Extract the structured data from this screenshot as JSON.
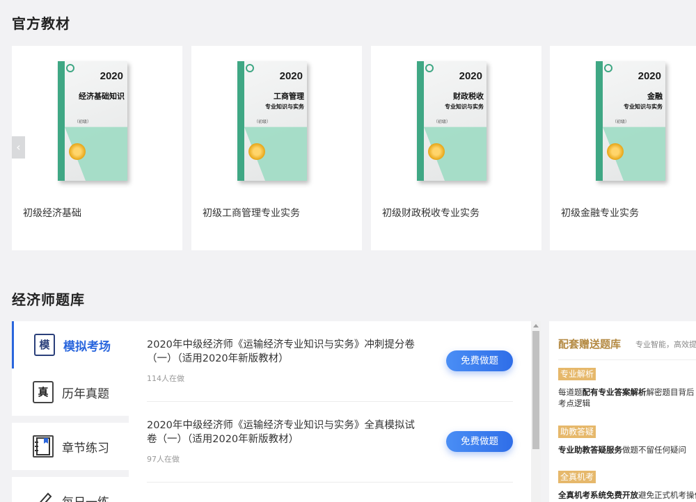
{
  "sections": {
    "textbooks_title": "官方教材",
    "bank_title": "经济师题库"
  },
  "textbooks": [
    {
      "title": "初级经济基础",
      "cover_year": "2020",
      "cover_name": "经济基础知识",
      "cover_sub": "",
      "cover_level": "（初级）"
    },
    {
      "title": "初级工商管理专业实务",
      "cover_year": "2020",
      "cover_name": "工商管理",
      "cover_sub": "专业知识与实务",
      "cover_level": "（初级）"
    },
    {
      "title": "初级财政税收专业实务",
      "cover_year": "2020",
      "cover_name": "财政税收",
      "cover_sub": "专业知识与实务",
      "cover_level": "（初级）"
    },
    {
      "title": "初级金融专业实务",
      "cover_year": "2020",
      "cover_name": "金融",
      "cover_sub": "专业知识与实务",
      "cover_level": "（初级）"
    }
  ],
  "carousel": {
    "prev_icon": "‹"
  },
  "bank_nav": [
    {
      "label": "模拟考场",
      "icon_char": "模",
      "icon": "exam-doc-icon",
      "active": true
    },
    {
      "label": "历年真题",
      "icon_char": "真",
      "icon": "clipboard-icon",
      "active": false
    },
    {
      "label": "章节练习",
      "icon_char": "",
      "icon": "notebook-icon",
      "active": false
    },
    {
      "label": "每日一练",
      "icon_char": "",
      "icon": "pencil-icon",
      "active": false
    }
  ],
  "papers": [
    {
      "title": "2020年中级经济师《运输经济专业知识与实务》冲刺提分卷（一）（适用2020年新版教材）",
      "count": "114人在做",
      "button": "免费做题"
    },
    {
      "title": "2020年中级经济师《运输经济专业知识与实务》全真模拟试卷（一）（适用2020年新版教材）",
      "count": "97人在做",
      "button": "免费做题"
    }
  ],
  "gift": {
    "title": "配套赠送题库",
    "subtitle": "专业智能，高效提",
    "features": [
      {
        "tag": "专业解析",
        "lead": "每道题",
        "bold": "配有专业答案解析",
        "rest": "解密题目背后考点逻辑"
      },
      {
        "tag": "助教答疑",
        "lead": "",
        "bold": "专业助教答疑服务",
        "rest": "做题不留任何疑问"
      },
      {
        "tag": "全真机考",
        "lead": "",
        "bold": "全真机考系统免费开放",
        "rest": "避免正式机考操作"
      }
    ]
  },
  "colors": {
    "accent": "#2a66dd",
    "gold": "#b48a43",
    "tag_bg": "#e6b86b"
  }
}
